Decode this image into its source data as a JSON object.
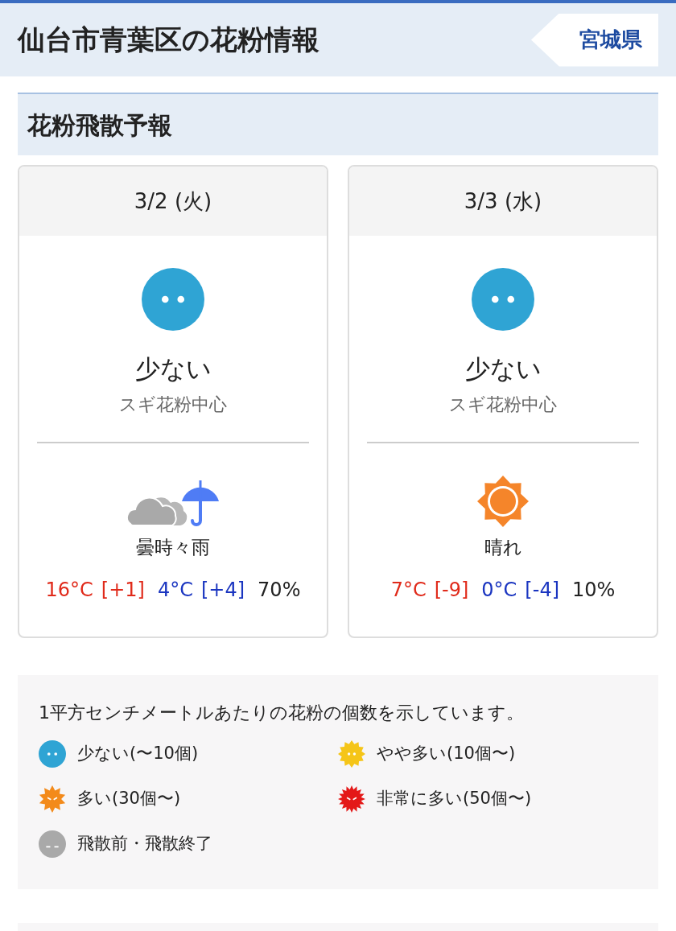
{
  "header": {
    "title": "仙台市青葉区の花粉情報",
    "prefecture_link": "宮城県"
  },
  "section": {
    "title": "花粉飛散予報"
  },
  "forecasts": [
    {
      "date": "3/2 (火)",
      "pollen": {
        "kind": "low",
        "level_text": "少ない",
        "type": "スギ花粉中心"
      },
      "weather": {
        "kind": "cloudy_rain",
        "label": "曇時々雨"
      },
      "high": "16°C",
      "high_diff": "[+1]",
      "low": "4°C",
      "low_diff": "[+4]",
      "precip": "70%"
    },
    {
      "date": "3/3 (水)",
      "pollen": {
        "kind": "low",
        "level_text": "少ない",
        "type": "スギ花粉中心"
      },
      "weather": {
        "kind": "sunny",
        "label": "晴れ"
      },
      "high": "7°C",
      "high_diff": "[-9]",
      "low": "0°C",
      "low_diff": "[-4]",
      "precip": "10%"
    }
  ],
  "legend": {
    "note": "1平方センチメートルあたりの花粉の個数を示しています。",
    "items": [
      {
        "kind": "low",
        "label": "少ない(〜10個)"
      },
      {
        "kind": "moderate",
        "label": "やや多い(10個〜)"
      },
      {
        "kind": "high",
        "label": "多い(30個〜)"
      },
      {
        "kind": "very_high",
        "label": "非常に多い(50個〜)"
      },
      {
        "kind": "none",
        "label": "飛散前・飛散終了"
      }
    ]
  }
}
